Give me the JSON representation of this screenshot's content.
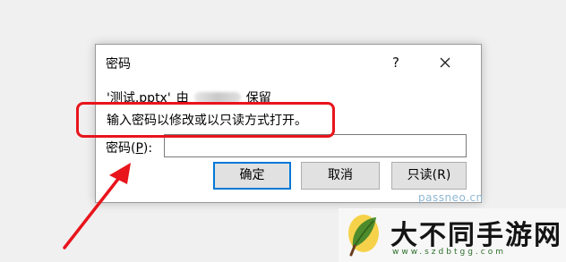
{
  "dialog": {
    "title": "密码",
    "help_label": "?",
    "file_name": "'测试.pptx'",
    "by_text": "由",
    "reserved_text": "保留",
    "message": "输入密码以修改或以只读方式打开。",
    "password_label_prefix": "密码(",
    "password_label_key": "P",
    "password_label_suffix": "):",
    "password_value": "",
    "buttons": {
      "ok": "确定",
      "cancel": "取消",
      "readonly": "只读(R)"
    }
  },
  "watermarks": {
    "small": "passneo.cn",
    "logo_text": "大不同手游网",
    "logo_url": "www.szdbtgg.com"
  },
  "annotation": {
    "color": "#e8151c"
  }
}
